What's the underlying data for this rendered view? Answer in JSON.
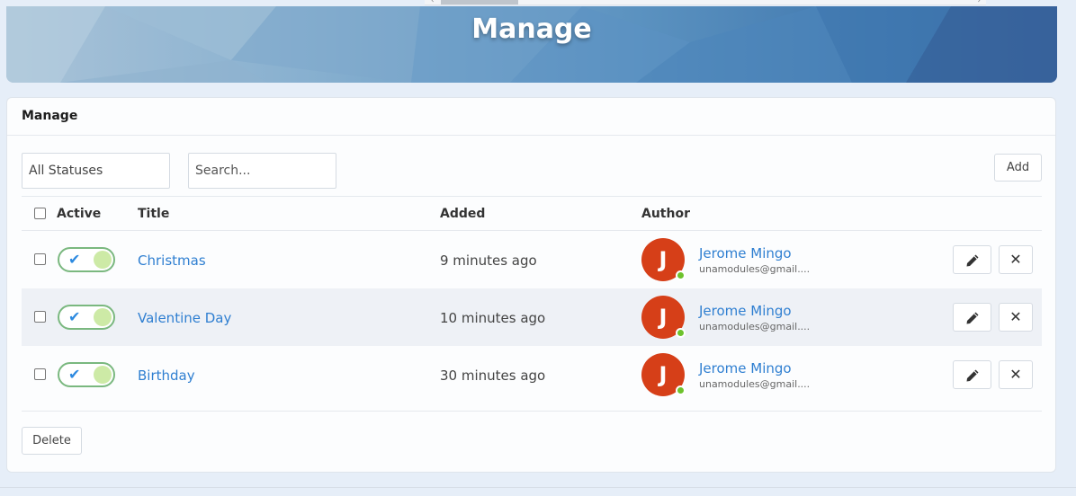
{
  "banner": {
    "title": "Manage"
  },
  "card": {
    "title": "Manage"
  },
  "filters": {
    "status_value": "All Statuses",
    "search_placeholder": "Search..."
  },
  "toolbar": {
    "add_label": "Add",
    "delete_label": "Delete"
  },
  "table": {
    "headers": {
      "active": "Active",
      "title": "Title",
      "added": "Added",
      "author": "Author"
    },
    "rows": [
      {
        "title": "Christmas",
        "added": "9 minutes ago",
        "author_initial": "J",
        "author_name": "Jerome Mingo",
        "author_email": "unamodules@gmail....",
        "active": true
      },
      {
        "title": "Valentine Day",
        "added": "10 minutes ago",
        "author_initial": "J",
        "author_name": "Jerome Mingo",
        "author_email": "unamodules@gmail....",
        "active": true
      },
      {
        "title": "Birthday",
        "added": "30 minutes ago",
        "author_initial": "J",
        "author_name": "Jerome Mingo",
        "author_email": "unamodules@gmail....",
        "active": true
      }
    ]
  },
  "icons": {
    "edit": "pencil-icon",
    "delete": "close-icon",
    "check": "check-icon"
  },
  "colors": {
    "link": "#2f7fd1",
    "avatar": "#d63f18",
    "online": "#6dc22c",
    "toggle_border": "#7ab87f"
  }
}
